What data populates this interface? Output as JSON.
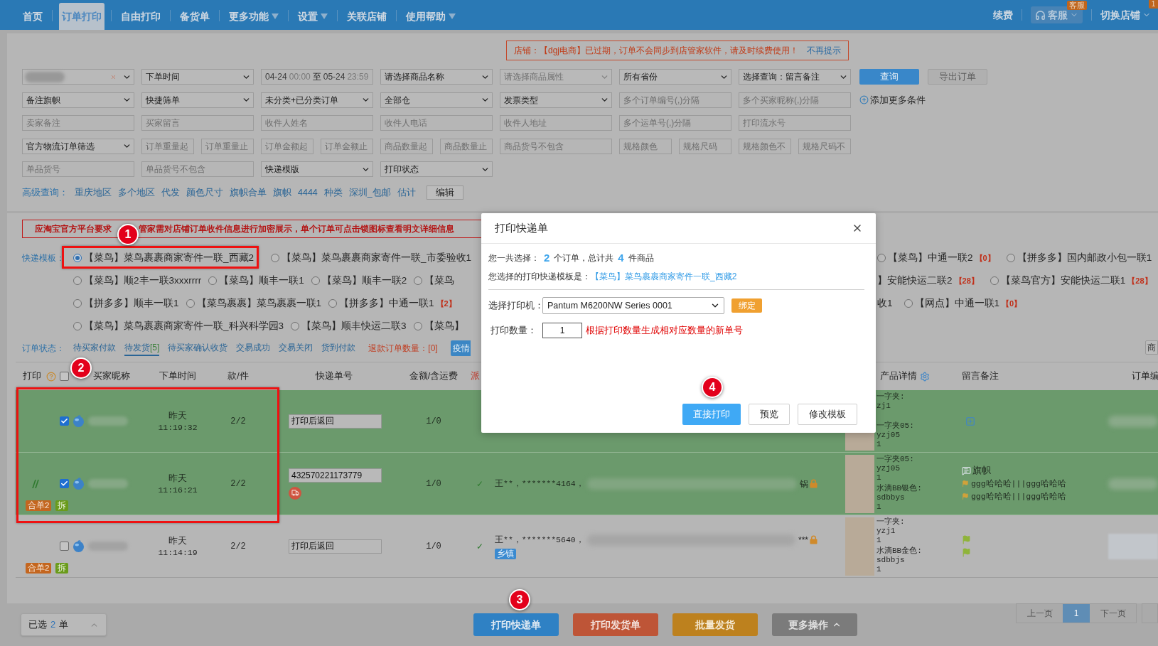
{
  "nav": {
    "tabs": [
      {
        "label": "首页",
        "selected": false,
        "dropdown": false
      },
      {
        "label": "订单打印",
        "selected": true,
        "dropdown": false
      },
      {
        "label": "自由打印",
        "selected": false,
        "dropdown": false
      },
      {
        "label": "备货单",
        "selected": false,
        "dropdown": false
      },
      {
        "label": "更多功能",
        "selected": false,
        "dropdown": true
      },
      {
        "label": "设置",
        "selected": false,
        "dropdown": true
      },
      {
        "label": "关联店铺",
        "selected": false,
        "dropdown": false
      },
      {
        "label": "使用帮助",
        "selected": false,
        "dropdown": true
      }
    ],
    "renew": "续费",
    "service": {
      "label": "客服",
      "badge": "客服"
    },
    "switch_shop": {
      "label": "切换店铺",
      "badge": "1"
    }
  },
  "expiry_notice": {
    "text": "店铺：【dgj电商】已过期，订单不会同步到店管家软件，请及时续费使用！",
    "link": "不再提示"
  },
  "filters": [
    {
      "fields": [
        {
          "kind": "shop_select"
        },
        {
          "kind": "select",
          "value": "下单时间"
        },
        {
          "kind": "date_range",
          "start_date": "04-24",
          "start_time": "00:00",
          "separator": "至",
          "end_date": "05-24",
          "end_time": "23:59"
        },
        {
          "kind": "select",
          "value": "请选择商品名称"
        },
        {
          "kind": "select",
          "placeholder": "请选择商品属性"
        },
        {
          "kind": "select",
          "value": "所有省份"
        },
        {
          "kind": "select",
          "value": "选择查询：留言备注"
        }
      ],
      "buttons": [
        {
          "label": "查询",
          "disabled": false
        },
        {
          "label": "导出订单",
          "disabled": true
        }
      ]
    },
    {
      "fields": [
        {
          "kind": "select",
          "value": "备注旗帜"
        },
        {
          "kind": "select",
          "value": "快捷筛单"
        },
        {
          "kind": "select",
          "value": "未分类+已分类订单"
        },
        {
          "kind": "select",
          "value": "全部仓"
        },
        {
          "kind": "select",
          "value": "发票类型"
        },
        {
          "kind": "input",
          "placeholder": "多个订单编号(,)分隔"
        },
        {
          "kind": "input",
          "placeholder": "多个买家昵称(,)分隔"
        }
      ],
      "add_link": "添加更多条件"
    },
    {
      "fields": [
        {
          "kind": "input",
          "placeholder": "卖家备注"
        },
        {
          "kind": "input",
          "placeholder": "买家留言"
        },
        {
          "kind": "input",
          "placeholder": "收件人姓名"
        },
        {
          "kind": "input",
          "placeholder": "收件人电话"
        },
        {
          "kind": "input",
          "placeholder": "收件人地址"
        },
        {
          "kind": "input",
          "placeholder": "多个运单号(,)分隔"
        },
        {
          "kind": "input",
          "placeholder": "打印流水号"
        }
      ]
    },
    {
      "fields": [
        {
          "kind": "select",
          "value": "官方物流订单筛选"
        },
        {
          "kind": "short_input",
          "placeholder": "订单重量起"
        },
        {
          "kind": "short_input",
          "placeholder": "订单重量止"
        },
        {
          "kind": "short_input",
          "placeholder": "订单金额起"
        },
        {
          "kind": "short_input",
          "placeholder": "订单金额止"
        },
        {
          "kind": "short_input",
          "placeholder": "商品数量起"
        },
        {
          "kind": "short_input",
          "placeholder": "商品数量止"
        },
        {
          "kind": "input",
          "placeholder": "商品货号不包含"
        },
        {
          "kind": "short_input",
          "placeholder": "规格颜色"
        },
        {
          "kind": "short_input",
          "placeholder": "规格尺码"
        },
        {
          "kind": "short_input",
          "placeholder": "规格颜色不"
        },
        {
          "kind": "short_input",
          "placeholder": "规格尺码不"
        }
      ]
    },
    {
      "fields": [
        {
          "kind": "input",
          "placeholder": "单品货号"
        },
        {
          "kind": "input",
          "placeholder": "单品货号不包含"
        },
        {
          "kind": "select",
          "value": "快递模版"
        },
        {
          "kind": "select",
          "value": "打印状态"
        }
      ]
    }
  ],
  "quick_queries": {
    "label": "高级查询：",
    "links": [
      "重庆地区",
      "多个地区",
      "代发",
      "颜色尺寸",
      "旗帜合单",
      "旗帜",
      "4444",
      "种类",
      "深圳_包邮",
      "估计"
    ],
    "edit": "编辑"
  },
  "encryption_notice": {
    "before": "应淘宝官方平台要求",
    "after": "管家需对店铺订单收件信息进行加密展示，单个订单可点击锁图标查看明文详细信息"
  },
  "templates": {
    "label": "快递模板：",
    "rows": [
      {
        "left": [
          {
            "label": "【菜鸟】菜鸟裹裹商家寄件一联_西藏2",
            "selected": true
          },
          {
            "label": "【菜鸟】菜鸟裹裹商家寄件一联_市委验收1",
            "selected": false
          }
        ],
        "right": [
          {
            "label": "【菜鸟】中通一联2",
            "count": "【0】",
            "selected": false
          },
          {
            "label": "【拼多多】国内邮政小包一联1",
            "selected": false
          }
        ]
      },
      {
        "left": [
          {
            "label": "【菜鸟】顺2丰一联3xxxrrrr",
            "selected": false
          },
          {
            "label": "【菜鸟】顺丰一联1",
            "selected": false
          },
          {
            "label": "【菜鸟】顺丰一联2",
            "selected": false
          },
          {
            "label": "【菜鸟",
            "selected": false
          }
        ],
        "right": [
          {
            "kind": "cut",
            "label": "】安能快运二联2",
            "count": "【28】"
          },
          {
            "label": "【菜鸟官方】安能快运二联1",
            "count": "【28】",
            "selected": false
          }
        ]
      },
      {
        "left": [
          {
            "label": "【拼多多】顺丰一联1",
            "selected": false
          },
          {
            "label": "【菜鸟裹裹】菜鸟裹裹一联1",
            "selected": false
          },
          {
            "label": "【拼多多】中通一联1",
            "count": "【2】",
            "selected": false
          }
        ],
        "right": [
          {
            "kind": "cut",
            "label": "收1"
          },
          {
            "label": "【网点】中通一联1",
            "count": "【0】",
            "selected": false
          }
        ]
      },
      {
        "left": [
          {
            "label": "【菜鸟】菜鸟裹裹商家寄件一联_科兴科学园3",
            "selected": false
          },
          {
            "label": "【菜鸟】顺丰快运二联3",
            "selected": false
          },
          {
            "label": "【菜鸟】",
            "selected": false
          }
        ]
      }
    ]
  },
  "order_status": {
    "label": "订单状态：",
    "tabs": [
      {
        "label": "待买家付款",
        "selected": false
      },
      {
        "label": "待发货",
        "count": "[5]",
        "selected": true
      },
      {
        "label": "待买家确认收货",
        "selected": false
      },
      {
        "label": "交易成功",
        "selected": false
      },
      {
        "label": "交易关闭",
        "selected": false
      },
      {
        "label": "货到付款",
        "selected": false
      }
    ],
    "refund": {
      "label": "退款订单数量：",
      "count": "[0]"
    },
    "cut_button": "疫情",
    "edge_button": "商"
  },
  "table": {
    "header": {
      "print": "打印",
      "select_all_checked": false,
      "columns": [
        "买家昵称",
        "下单时间",
        "款/件",
        "快递单号",
        "金额/含运费",
        "派",
        "产品详情",
        "留言备注",
        "订单编"
      ]
    },
    "rows": [
      {
        "selected": true,
        "checked": true,
        "printed": false,
        "date": "昨天",
        "time": "11:19:32",
        "quantity": "2/2",
        "tracking": "打印后返回",
        "shipping": false,
        "amount": "1/0",
        "products": [
          {
            "kind": "plain",
            "name": "一字夹:",
            "code": "zj1"
          },
          {
            "kind": "photo",
            "name": "一字夹05:",
            "code": "yzj05",
            "qty": "1"
          }
        ],
        "remarks": [
          {
            "kind": "add"
          }
        ]
      },
      {
        "selected": true,
        "checked": true,
        "printed": true,
        "date": "昨天",
        "time": "11:16:21",
        "quantity": "2/2",
        "tracking": "432570221173779",
        "shipping": true,
        "amount": "1/0",
        "check": "✓",
        "receiver": {
          "text": "王**，*******4164，",
          "tail": "锅"
        },
        "products": [
          {
            "kind": "photo",
            "name": "一字夹05:",
            "code": "yzj05",
            "qty": "1"
          },
          {
            "kind": "photo",
            "name": "水滴BB银色:",
            "code": "sdbbys",
            "qty": "1"
          }
        ],
        "remarks": [
          {
            "kind": "memo",
            "text": "旗帜"
          },
          {
            "kind": "flag",
            "color": "#d1a23a",
            "text": "ggg哈哈哈|||ggg哈哈哈"
          },
          {
            "kind": "flag",
            "color": "#d1a23a",
            "text": "ggg哈哈哈|||ggg哈哈哈"
          }
        ],
        "badges": [
          "合单2",
          "拆"
        ]
      },
      {
        "selected": false,
        "checked": false,
        "printed": false,
        "date": "昨天",
        "time": "11:14:19",
        "quantity": "2/2",
        "tracking": "打印后返回",
        "shipping": false,
        "amount": "1/0",
        "check": "✓",
        "receiver": {
          "text": "王**，*******5640，",
          "tail": "***",
          "tag": "乡镇"
        },
        "products": [
          {
            "kind": "photo",
            "name": "一字夹:",
            "code": "yzj1",
            "qty": "1"
          },
          {
            "kind": "photo",
            "name": "水滴BB金色:",
            "code": "sdbbjs",
            "qty": "1"
          }
        ],
        "remarks": [
          {
            "kind": "flag",
            "color": "#8fb43a"
          },
          {
            "kind": "flag",
            "color": "#8fb43a"
          }
        ],
        "badges": [
          "合单2",
          "拆"
        ]
      }
    ]
  },
  "pagination": {
    "prev": "上一页",
    "pages": [
      {
        "label": "1",
        "selected": true
      }
    ],
    "next": "下一页"
  },
  "footer": {
    "selected": {
      "prefix": "已选",
      "count": "2",
      "suffix": "单"
    },
    "buttons": [
      {
        "label": "打印快递单",
        "kind": "express"
      },
      {
        "label": "打印发货单",
        "kind": "invoice"
      },
      {
        "label": "批量发货",
        "kind": "ship"
      },
      {
        "label": "更多操作",
        "kind": "more"
      }
    ]
  },
  "dialog": {
    "title": "打印快递单",
    "summary": {
      "prefix": "您一共选择：",
      "orders": "2",
      "middle": "个订单，总计共",
      "items": "4",
      "suffix": "件商品"
    },
    "template": {
      "label": "您选择的打印快递模板是：",
      "value": "【菜鸟】菜鸟裹裹商家寄件一联_西藏2"
    },
    "printer": {
      "label": "选择打印机：",
      "value": "Pantum M6200NW Series 0001",
      "bind": "绑定"
    },
    "copies": {
      "label": "打印数量：",
      "value": "1",
      "hint": "根据打印数量生成相对应数量的新单号"
    },
    "buttons": [
      {
        "label": "直接打印",
        "primary": true
      },
      {
        "label": "预览",
        "primary": false
      },
      {
        "label": "修改模板",
        "primary": false
      }
    ]
  },
  "callouts": [
    "1",
    "2",
    "3",
    "4"
  ]
}
